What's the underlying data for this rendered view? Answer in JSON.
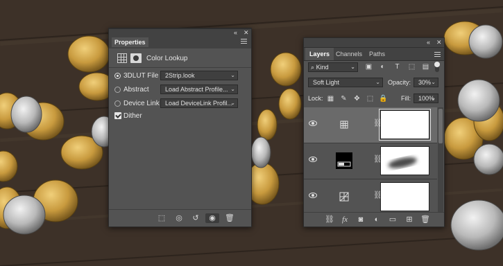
{
  "properties": {
    "collapse_glyph": "«",
    "close_glyph": "✕",
    "title": "Properties",
    "adjustment_name": "Color Lookup",
    "options": [
      {
        "label": "3DLUT File",
        "selected": true,
        "value": "2Strip.look"
      },
      {
        "label": "Abstract",
        "selected": false,
        "value": "Load Abstract Profile..."
      },
      {
        "label": "Device Link",
        "selected": false,
        "value": "Load DeviceLink Profil..."
      }
    ],
    "dither_label": "Dither",
    "dither_checked": true,
    "footer_icons": [
      "clip-to-layer-icon",
      "view-previous-state-icon",
      "reset-icon",
      "visibility-icon",
      "trash-icon"
    ]
  },
  "layers": {
    "collapse_glyph": "«",
    "close_glyph": "✕",
    "tabs": [
      {
        "label": "Layers",
        "active": true
      },
      {
        "label": "Channels",
        "active": false
      },
      {
        "label": "Paths",
        "active": false
      }
    ],
    "filter_kind": "Kind",
    "blend_mode": "Soft Light",
    "opacity_label": "Opacity:",
    "opacity_value": "30%",
    "lock_label": "Lock:",
    "fill_label": "Fill:",
    "fill_value": "100%",
    "items": [
      {
        "type": "color-lookup-adjustment",
        "visible": true,
        "selected": true
      },
      {
        "type": "levels-adjustment",
        "visible": true,
        "selected": false
      },
      {
        "type": "curves-adjustment",
        "visible": true,
        "selected": false
      }
    ],
    "footer_icons": [
      "link-icon",
      "fx-icon",
      "add-mask-icon",
      "adjustment-icon",
      "group-icon",
      "new-layer-icon",
      "trash-icon"
    ]
  },
  "colors": {
    "panel_bg": "#535353",
    "panel_header": "#424242",
    "wood": "#3a2f26"
  }
}
